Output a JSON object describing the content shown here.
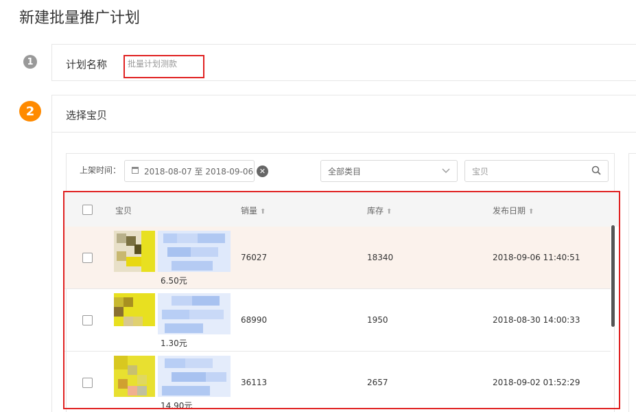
{
  "page": {
    "title": "新建批量推广计划"
  },
  "step1": {
    "num": "1",
    "label": "计划名称",
    "input_value": "批量计划测款"
  },
  "step2": {
    "num": "2",
    "label": "选择宝贝"
  },
  "filters": {
    "shelf_label": "上架时间：",
    "date_range": "2018-08-07 至 2018-09-06",
    "category_value": "全部类目",
    "search_placeholder": "宝贝"
  },
  "table": {
    "headers": {
      "item": "宝贝",
      "sales": "销量",
      "stock": "库存",
      "date": "发布日期"
    },
    "rows": [
      {
        "price": "6.50元",
        "sales": "76027",
        "stock": "18340",
        "date": "2018-09-06 11:40:51"
      },
      {
        "price": "1.30元",
        "sales": "68990",
        "stock": "1950",
        "date": "2018-08-30 14:00:33"
      },
      {
        "price": "14.90元",
        "sales": "36113",
        "stock": "2657",
        "date": "2018-09-02 01:52:29"
      }
    ]
  },
  "colors": {
    "accent": "#ff8a00",
    "highlight_border": "#e02020",
    "row_highlight": "#fbf2ec"
  },
  "icons": [
    "calendar-icon",
    "clear-icon",
    "chevron-down-icon",
    "search-icon",
    "sort-up-icon"
  ]
}
